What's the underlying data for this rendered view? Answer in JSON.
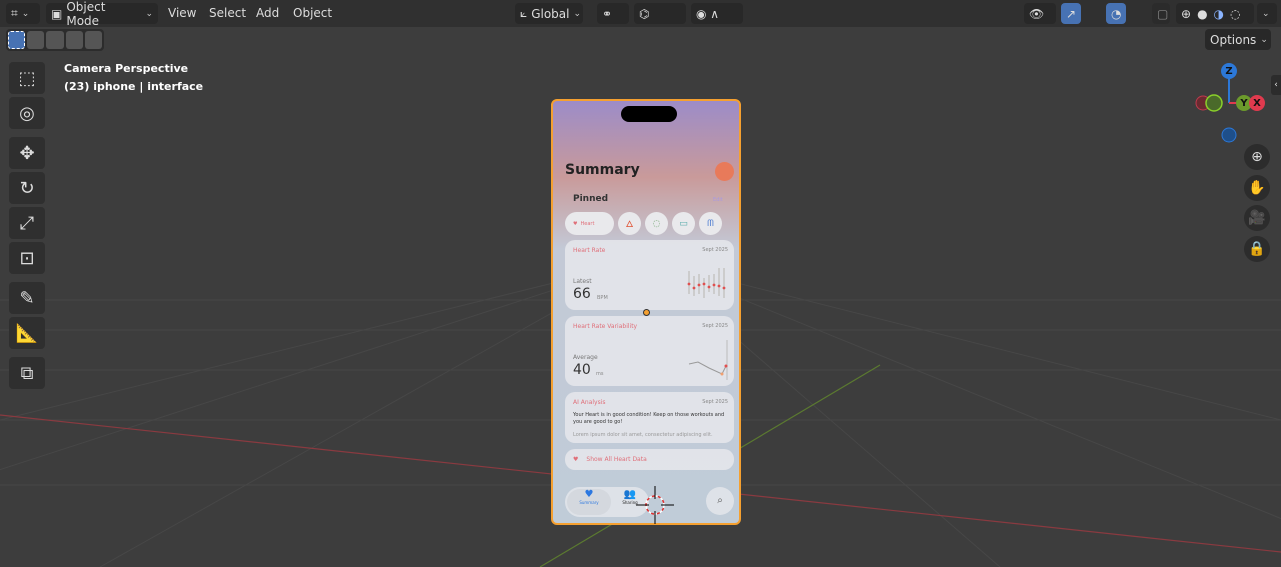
{
  "header": {
    "mode": "Object Mode",
    "menus": [
      "View",
      "Select",
      "Add",
      "Object"
    ],
    "transform_orientation": "Global",
    "options": "Options"
  },
  "overlay": {
    "view": "Camera Perspective",
    "object": "(23) iphone | interface"
  },
  "gizmo": {
    "z": "Z",
    "y": "Y",
    "x": "X"
  },
  "phone": {
    "title": "Summary",
    "pinned": "Pinned",
    "edit": "Edit",
    "pin_heart": "Heart",
    "heart_rate": {
      "title": "Heart Rate",
      "date": "Sept 2025",
      "label": "Latest",
      "value": "66",
      "unit": "BPM"
    },
    "hrv": {
      "title": "Heart Rate Variability",
      "date": "Sept 2025",
      "label": "Average",
      "value": "40",
      "unit": "ms"
    },
    "ai": {
      "title": "AI Analysis",
      "date": "Sept 2025",
      "text": "Your Heart is in good condition! Keep on those workouts and you are good to go!",
      "lorem": "Lorem ipsum dolor sit amet, consectetur adipiscing elit."
    },
    "show_all": "Show All Heart Data",
    "tabs": [
      "Summary",
      "Sharing"
    ]
  },
  "colors": {
    "selection": "#f5a030",
    "accent": "#4772b3",
    "x_axis": "#e03a4e",
    "y_axis": "#6c9a2c",
    "z_axis": "#2c78d8"
  }
}
